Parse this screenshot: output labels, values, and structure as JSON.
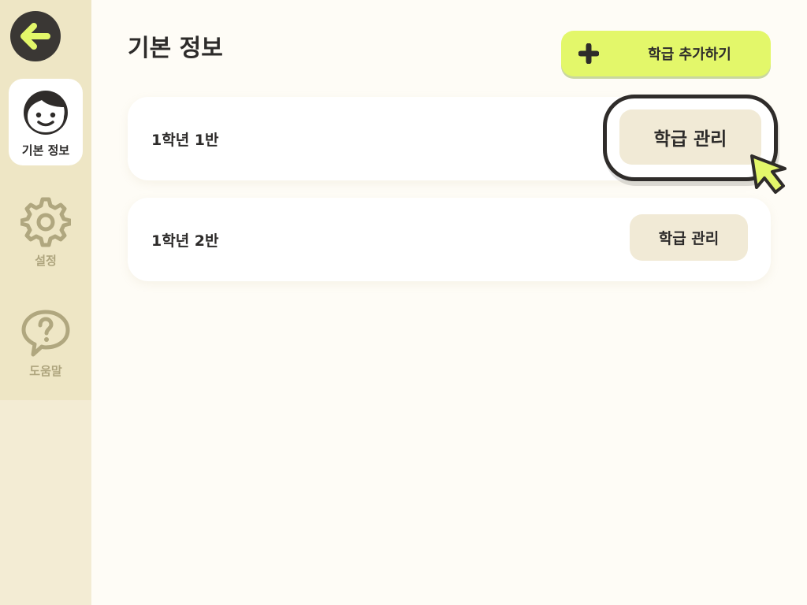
{
  "sidebar": {
    "back": {
      "icon": "arrow-left-icon"
    },
    "items": [
      {
        "label": "기본 정보",
        "icon": "smiley-face-icon",
        "active": true
      },
      {
        "label": "설정",
        "icon": "gear-icon",
        "active": false
      },
      {
        "label": "도움말",
        "icon": "question-bubble-icon",
        "active": false
      }
    ]
  },
  "main": {
    "title": "기본 정보",
    "add_button": {
      "label": "학급 추가하기",
      "icon": "plus-icon"
    },
    "classes": [
      {
        "name": "1학년 1반",
        "manage_label": "학급 관리"
      },
      {
        "name": "1학년 2반",
        "manage_label": "학급 관리"
      }
    ]
  },
  "colors": {
    "sidebar_bg": "#f3ecd4",
    "accent": "#e3f76a",
    "dark": "#2d2b2a",
    "muted": "#aea57e",
    "button_bg": "#f1ead6"
  }
}
